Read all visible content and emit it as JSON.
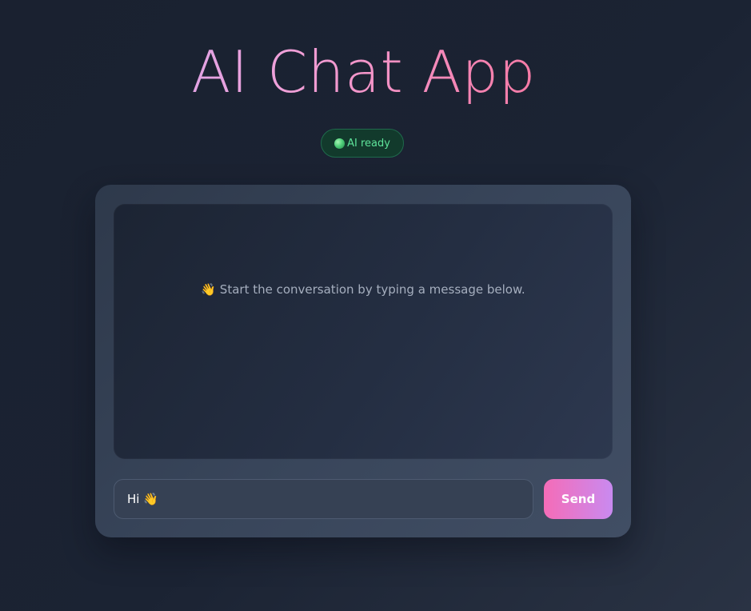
{
  "app": {
    "title": "AI Chat App"
  },
  "status": {
    "label": "AI ready",
    "color": "#5ee39a"
  },
  "chat": {
    "empty_message": "👋 Start the conversation by typing a message below."
  },
  "composer": {
    "input_value": "Hi 👋",
    "send_label": "Send"
  },
  "colors": {
    "title_gradient_start": "#c4a8f7",
    "title_gradient_end": "#f35f86",
    "send_gradient_start": "#f56cb7",
    "send_gradient_end": "#c98af0",
    "status_background": "#123a2c"
  }
}
